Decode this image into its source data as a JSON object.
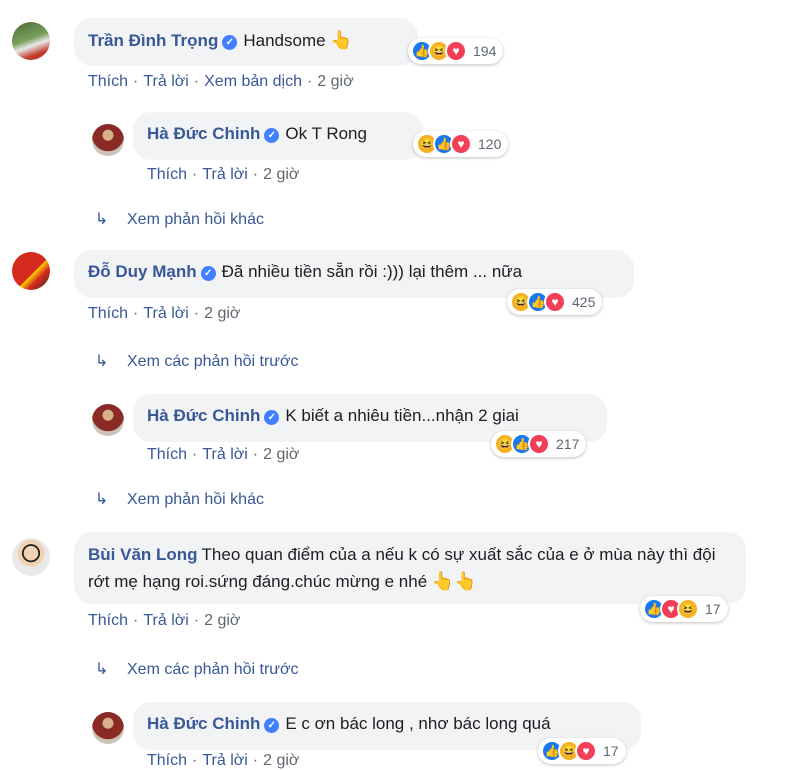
{
  "comments": [
    {
      "name": "Trần Đình Trọng",
      "text": "Handsome",
      "emoji": "👆",
      "reactions": [
        "like",
        "haha",
        "love"
      ],
      "count": "194",
      "actions": {
        "like": "Thích",
        "reply": "Trả lời",
        "translate": "Xem bản dịch",
        "time": "2 giờ"
      }
    },
    {
      "name": "Hà Đức Chinh",
      "text": "Ok T Rong",
      "reactions": [
        "haha",
        "like",
        "love"
      ],
      "count": "120",
      "actions": {
        "like": "Thích",
        "reply": "Trả lời",
        "time": "2 giờ"
      }
    },
    {
      "name": "Đỗ Duy Mạnh",
      "text": "Đã nhiều tiền sẵn rồi :))) lại thêm ... nữa",
      "reactions": [
        "haha",
        "like",
        "love"
      ],
      "count": "425",
      "actions": {
        "like": "Thích",
        "reply": "Trả lời",
        "time": "2 giờ"
      }
    },
    {
      "name": "Hà Đức Chinh",
      "text": "K biết a nhiêu tiền...nhận 2 giai",
      "reactions": [
        "haha",
        "like",
        "love"
      ],
      "count": "217",
      "actions": {
        "like": "Thích",
        "reply": "Trả lời",
        "time": "2 giờ"
      }
    },
    {
      "name": "Bùi Văn Long",
      "text": "Theo quan điểm của a nếu k có sự xuất sắc của e ở mùa này thì đội rớt mẹ hạng roi.sứng đáng.chúc mừng e nhé",
      "emoji": "👆👆",
      "reactions": [
        "like",
        "love",
        "haha"
      ],
      "count": "17",
      "actions": {
        "like": "Thích",
        "reply": "Trả lời",
        "time": "2 giờ"
      }
    },
    {
      "name": "Hà Đức Chinh",
      "text": "E c ơn bác long , nhơ bác long quá",
      "reactions": [
        "like",
        "haha",
        "love"
      ],
      "count": "17",
      "actions": {
        "like": "Thích",
        "reply": "Trả lời",
        "time": "2 giờ"
      }
    }
  ],
  "more_replies": {
    "other": "Xem phản hồi khác",
    "previous": "Xem các phản hồi trước"
  },
  "colors": {
    "link": "#385898",
    "bubble": "#f2f3f5",
    "meta": "#606770"
  }
}
